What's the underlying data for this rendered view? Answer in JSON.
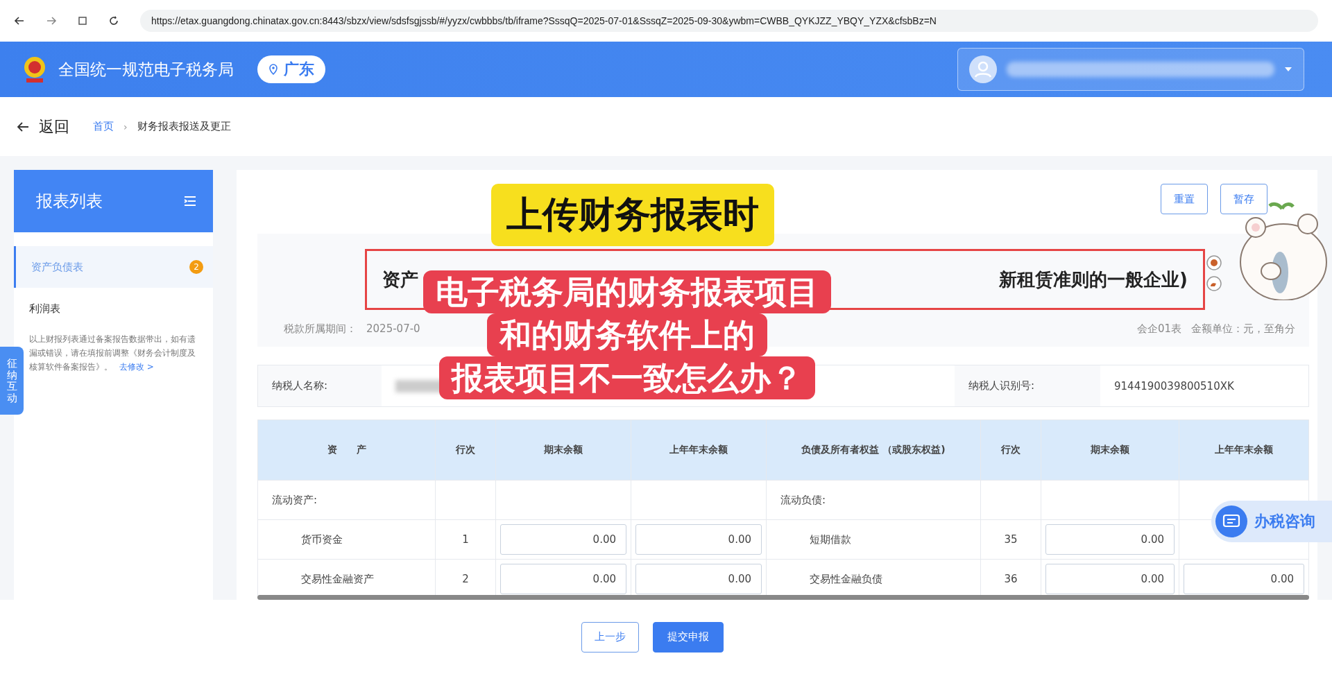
{
  "browser": {
    "url": "https://etax.guangdong.chinatax.gov.cn:8443/sbzx/view/sdsfsgjssb/#/yyzx/cwbbbs/tb/iframe?SssqQ=2025-07-01&SssqZ=2025-09-30&ywbm=CWBB_QYKJZZ_YBQY_YZX&cfsbBz=N"
  },
  "header": {
    "title": "全国统一规范电子税务局",
    "region": "广东"
  },
  "nav": {
    "back": "返回",
    "breadcrumb": [
      "首页",
      "财务报表报送及更正"
    ],
    "separator": "›"
  },
  "sidebar": {
    "title": "报表列表",
    "items": [
      {
        "label": "资产负债表",
        "selected": true,
        "badge": "2"
      },
      {
        "label": "利润表",
        "selected": false
      }
    ],
    "note": "以上财报列表通过备案报告数据带出，如有遗漏或错误，请在填报前调整《财务会计制度及核算软件备案报告》。",
    "note_link": "去修改 >"
  },
  "side_tab": "征纳互动",
  "toolbar": {
    "buttons": [
      "重置",
      "暂存"
    ]
  },
  "report": {
    "title_start": "资产",
    "title_end": "新租赁准则的一般企业)",
    "period_label": "税款所属期间：",
    "period_value": "2025-07-0",
    "form_code": "会企01表",
    "unit": "金额单位：元，至角分",
    "taxpayer_name_label": "纳税人名称:",
    "taxpayer_id_label": "纳税人识别号:",
    "taxpayer_id": "9144190039800510XK",
    "columns": [
      "资　　产",
      "行次",
      "期末余额",
      "上年年末余额",
      "负债及所有者权益 （或股东权益)",
      "行次",
      "期末余额",
      "上年年末余额"
    ],
    "rows": [
      {
        "kind": "section",
        "asset": "流动资产:",
        "liability": "流动负债:"
      },
      {
        "kind": "entry",
        "asset": "货币资金",
        "asset_line": "1",
        "asset_end": "0.00",
        "asset_prev": "0.00",
        "liability": "短期借款",
        "liability_line": "35",
        "liability_end": "0.00"
      },
      {
        "kind": "entry",
        "asset": "交易性金融资产",
        "asset_line": "2",
        "asset_end": "0.00",
        "asset_prev": "0.00",
        "liability": "交易性金融负债",
        "liability_line": "36",
        "liability_end": "0.00",
        "liability_prev": "0.00"
      }
    ]
  },
  "footer": {
    "buttons": [
      {
        "label": "上一步",
        "primary": false
      },
      {
        "label": "提交申报",
        "primary": true
      }
    ]
  },
  "consult": "办税咨询",
  "captions": [
    {
      "lines": [
        "上传财务报表时"
      ],
      "kind": "yellow"
    },
    {
      "lines": [
        "电子税务局的财务报表项目",
        "和的财务软件上的",
        "报表项目不一致怎么办？"
      ],
      "kind": "red"
    }
  ]
}
